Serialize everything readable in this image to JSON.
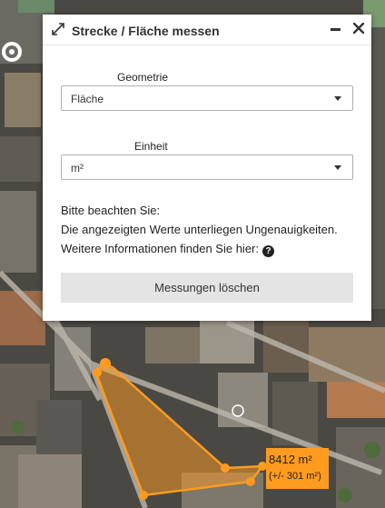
{
  "panel": {
    "title": "Strecke / Fläche messen",
    "geometry": {
      "label": "Geometrie",
      "selected": "Fläche"
    },
    "unit": {
      "label": "Einheit",
      "selected": "m²"
    },
    "notice": {
      "line1": "Bitte beachten Sie:",
      "line2": "Die angezeigten Werte unterliegen Ungenauigkeiten.",
      "line3": "Weitere Informationen finden Sie hier:"
    },
    "clear_button": "Messungen löschen"
  },
  "measurement": {
    "area": "8412 m²",
    "error": "(+/- 301 m²)"
  },
  "icons": {
    "expand": "expand-icon",
    "minimize": "minimize-icon",
    "close": "close-icon",
    "help": "help-circle-icon"
  },
  "colors": {
    "accent_orange": "#ff9b1f",
    "panel_background": "#ffffff",
    "button_background": "#e4e4e4"
  }
}
